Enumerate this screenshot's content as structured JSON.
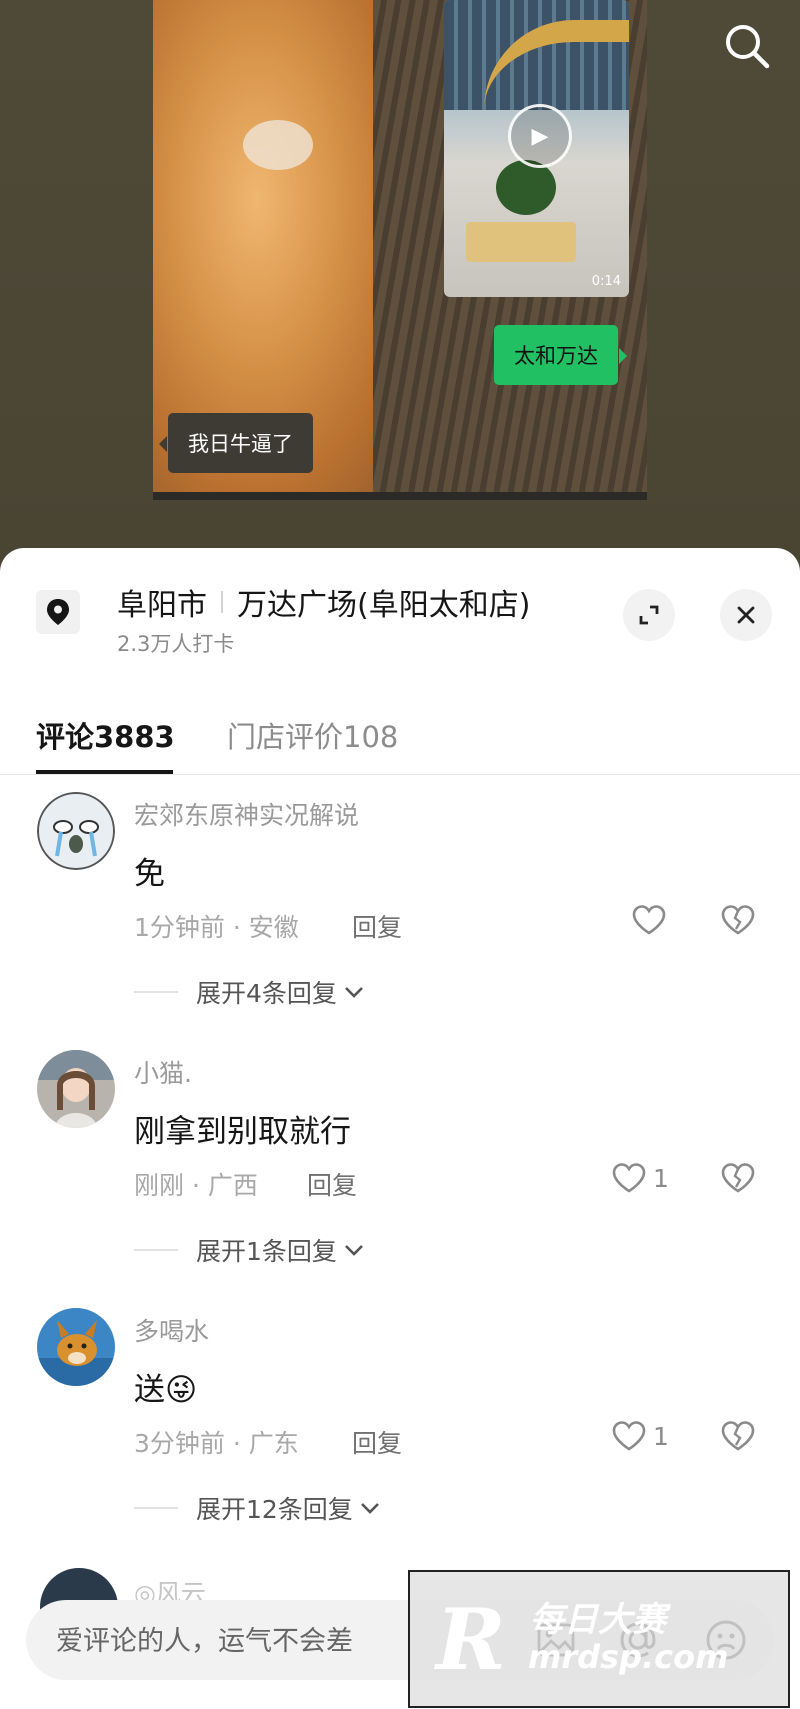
{
  "video": {
    "thumbnail_duration": "0:14",
    "bubble_green": "太和万达",
    "bubble_dark": "我日牛逼了"
  },
  "location": {
    "city": "阜阳市",
    "place": "万达广场(阜阳太和店)",
    "checkins": "2.3万人打卡"
  },
  "tabs": {
    "comments": "评论3883",
    "reviews": "门店评价108"
  },
  "comments": [
    {
      "user": "宏郊东原神实况解说",
      "text": "免",
      "meta": "1分钟前 · 安徽",
      "reply": "回复",
      "likes": "",
      "expand": "展开4条回复"
    },
    {
      "user": "小猫.",
      "text": "刚拿到别取就行",
      "meta": "刚刚 · 广西",
      "reply": "回复",
      "likes": "1",
      "expand": "展开1条回复"
    },
    {
      "user": "多喝水",
      "text": "送😜",
      "meta": "3分钟前 · 广东",
      "reply": "回复",
      "likes": "1",
      "expand": "展开12条回复"
    }
  ],
  "partial_comment": {
    "user": "◎风云"
  },
  "input": {
    "placeholder": "爱评论的人，运气不会差"
  },
  "watermark": {
    "brand_cn": "每日大赛",
    "url": "mrdsp.com",
    "letter": "R"
  },
  "colors": {
    "accent_green": "#21c063",
    "sheet_bg": "#ffffff",
    "backdrop": "#4d4735"
  }
}
